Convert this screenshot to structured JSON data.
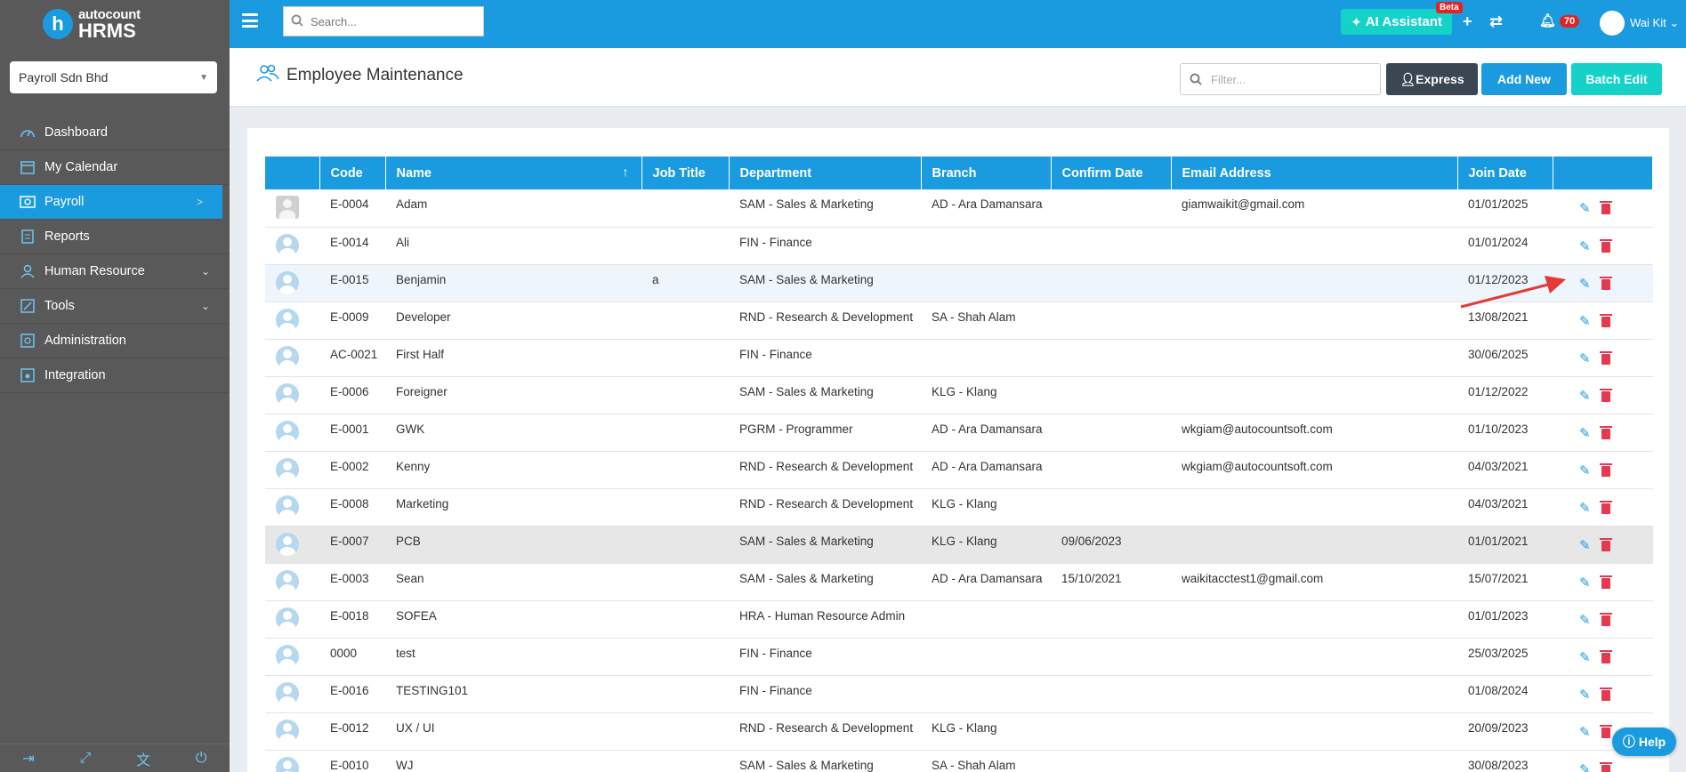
{
  "app": {
    "logo_top": "autocount",
    "logo_bottom": "HRMS",
    "company": "Payroll Sdn Bhd"
  },
  "sidebar": {
    "items": [
      {
        "label": "Dashboard",
        "icon": "gauge-icon"
      },
      {
        "label": "My Calendar",
        "icon": "calendar-icon"
      },
      {
        "label": "Payroll",
        "icon": "payroll-icon",
        "active": true
      },
      {
        "label": "Reports",
        "icon": "report-icon"
      },
      {
        "label": "Human Resource",
        "icon": "hr-icon"
      },
      {
        "label": "Tools",
        "icon": "tools-icon"
      },
      {
        "label": "Administration",
        "icon": "admin-icon"
      },
      {
        "label": "Integration",
        "icon": "integration-icon"
      }
    ]
  },
  "topbar": {
    "search_placeholder": "Search...",
    "ai_label": "AI Assistant",
    "beta_label": "Beta",
    "notification_count": "70",
    "user_name": "Wai Kit"
  },
  "header": {
    "title": "Employee Maintenance",
    "filter_placeholder": "Filter...",
    "express_label": "Express",
    "add_new_label": "Add New",
    "batch_edit_label": "Batch Edit"
  },
  "table": {
    "columns": [
      "Code",
      "Name",
      "Job Title",
      "Department",
      "Branch",
      "Confirm Date",
      "Email Address",
      "Join Date"
    ],
    "rows": [
      {
        "code": "E-0004",
        "name": "Adam",
        "job": "",
        "dept": "SAM - Sales & Marketing",
        "branch": "AD - Ara Damansara",
        "confirm": "",
        "email": "giamwaikit@gmail.com",
        "join": "01/01/2025"
      },
      {
        "code": "E-0014",
        "name": "Ali",
        "job": "",
        "dept": "FIN - Finance",
        "branch": "",
        "confirm": "",
        "email": "",
        "join": "01/01/2024"
      },
      {
        "code": "E-0015",
        "name": "Benjamin",
        "job": "a",
        "dept": "SAM - Sales & Marketing",
        "branch": "",
        "confirm": "",
        "email": "",
        "join": "01/12/2023"
      },
      {
        "code": "E-0009",
        "name": "Developer",
        "job": "",
        "dept": "RND - Research & Development",
        "branch": "SA - Shah Alam",
        "confirm": "",
        "email": "",
        "join": "13/08/2021"
      },
      {
        "code": "AC-0021",
        "name": "First Half",
        "job": "",
        "dept": "FIN - Finance",
        "branch": "",
        "confirm": "",
        "email": "",
        "join": "30/06/2025"
      },
      {
        "code": "E-0006",
        "name": "Foreigner",
        "job": "",
        "dept": "SAM - Sales & Marketing",
        "branch": "KLG - Klang",
        "confirm": "",
        "email": "",
        "join": "01/12/2022"
      },
      {
        "code": "E-0001",
        "name": "GWK",
        "job": "",
        "dept": "PGRM - Programmer",
        "branch": "AD - Ara Damansara",
        "confirm": "",
        "email": "wkgiam@autocountsoft.com",
        "join": "01/10/2023"
      },
      {
        "code": "E-0002",
        "name": "Kenny",
        "job": "",
        "dept": "RND - Research & Development",
        "branch": "AD - Ara Damansara",
        "confirm": "",
        "email": "wkgiam@autocountsoft.com",
        "join": "04/03/2021"
      },
      {
        "code": "E-0008",
        "name": "Marketing",
        "job": "",
        "dept": "RND - Research & Development",
        "branch": "KLG - Klang",
        "confirm": "",
        "email": "",
        "join": "04/03/2021"
      },
      {
        "code": "E-0007",
        "name": "PCB",
        "job": "",
        "dept": "SAM - Sales & Marketing",
        "branch": "KLG - Klang",
        "confirm": "09/06/2023",
        "email": "",
        "join": "01/01/2021"
      },
      {
        "code": "E-0003",
        "name": "Sean",
        "job": "",
        "dept": "SAM - Sales & Marketing",
        "branch": "AD - Ara Damansara",
        "confirm": "15/10/2021",
        "email": "waikitacctest1@gmail.com",
        "join": "15/07/2021"
      },
      {
        "code": "E-0018",
        "name": "SOFEA",
        "job": "",
        "dept": "HRA - Human Resource Admin",
        "branch": "",
        "confirm": "",
        "email": "",
        "join": "01/01/2023"
      },
      {
        "code": "0000",
        "name": "test",
        "job": "",
        "dept": "FIN - Finance",
        "branch": "",
        "confirm": "",
        "email": "",
        "join": "25/03/2025"
      },
      {
        "code": "E-0016",
        "name": "TESTING101",
        "job": "",
        "dept": "FIN - Finance",
        "branch": "",
        "confirm": "",
        "email": "",
        "join": "01/08/2024"
      },
      {
        "code": "E-0012",
        "name": "UX / UI",
        "job": "",
        "dept": "RND - Research & Development",
        "branch": "KLG - Klang",
        "confirm": "",
        "email": "",
        "join": "20/09/2023"
      },
      {
        "code": "E-0010",
        "name": "WJ",
        "job": "",
        "dept": "SAM - Sales & Marketing",
        "branch": "SA - Shah Alam",
        "confirm": "",
        "email": "",
        "join": "30/08/2023"
      }
    ]
  },
  "help_label": "Help",
  "colors": {
    "accent": "#1a9be0",
    "teal": "#14d2c8",
    "sidebar": "#595959",
    "danger": "#e53950"
  }
}
